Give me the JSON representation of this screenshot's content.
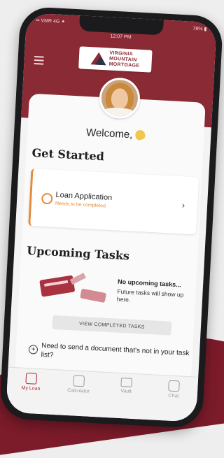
{
  "colors": {
    "brand": "#8a2a35",
    "accent": "#e58a3a",
    "active_tab": "#a52a3a"
  },
  "status_bar": {
    "carrier": "•• VMR 4G ✦",
    "time": "12:07 PM",
    "battery": "78% ▮"
  },
  "logo": {
    "line1": "VIRGINIA",
    "line2": "MOUNTAIN",
    "line3": "MORTGAGE"
  },
  "welcome": {
    "text": "Welcome,"
  },
  "get_started": {
    "heading": "Get Started",
    "items": [
      {
        "title": "Loan Application",
        "status": "Needs to be completed",
        "icon": "document-icon"
      }
    ]
  },
  "upcoming": {
    "heading": "Upcoming Tasks",
    "empty_title": "No upcoming tasks...",
    "empty_sub": "Future tasks will show up here.",
    "view_button": "VIEW COMPLETED TASKS"
  },
  "send_doc": {
    "text": "Need to send a document that's not in your task list?"
  },
  "tabs": [
    {
      "label": "My Loan",
      "icon": "my-loan-icon",
      "active": true
    },
    {
      "label": "Calculator",
      "icon": "calculator-icon",
      "active": false
    },
    {
      "label": "Vault",
      "icon": "vault-icon",
      "active": false
    },
    {
      "label": "Chat",
      "icon": "chat-icon",
      "active": false
    }
  ]
}
